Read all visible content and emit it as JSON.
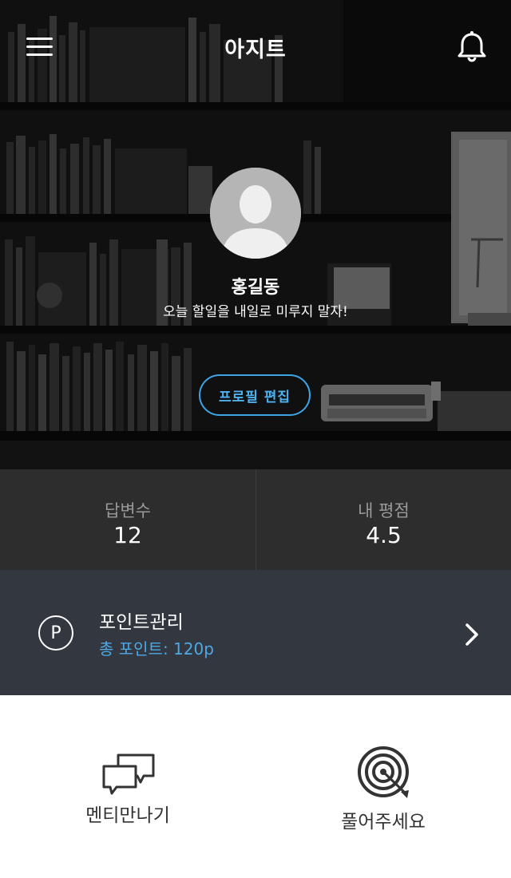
{
  "header": {
    "title": "아지트",
    "menu_icon": "hamburger-menu-icon",
    "notification_icon": "bell-icon"
  },
  "profile": {
    "avatar_icon": "default-user-avatar",
    "name": "홍길동",
    "status_message": "오늘 할일을 내일로 미루지 말자!",
    "edit_button_label": "프로필 편집"
  },
  "stats": [
    {
      "label": "답변수",
      "value": "12"
    },
    {
      "label": "내 평점",
      "value": "4.5"
    }
  ],
  "points": {
    "icon_letter": "P",
    "title": "포인트관리",
    "total": "총 포인트: 120p",
    "chevron_icon": "chevron-right-icon"
  },
  "bottom_menu": [
    {
      "label": "멘티만나기",
      "icon": "chat-bubbles-icon"
    },
    {
      "label": "풀어주세요",
      "icon": "target-icon"
    }
  ],
  "colors": {
    "accent_blue": "#4ea8e6",
    "stats_bg": "#2d2d2d",
    "points_bg": "#333840",
    "hero_bg": "#161616"
  }
}
